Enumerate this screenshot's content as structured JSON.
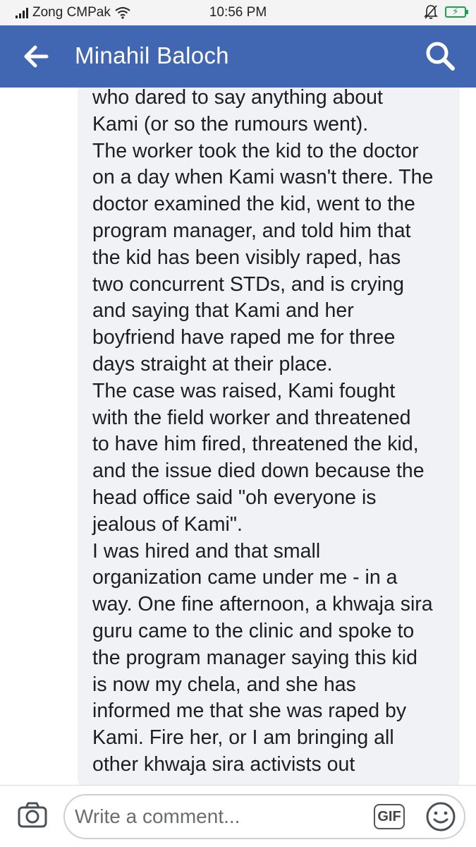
{
  "status_bar": {
    "carrier": "Zong CMPak",
    "time": "10:56 PM",
    "icons": [
      "signal-icon",
      "wifi-icon",
      "alarm-off-icon",
      "battery-charging-icon"
    ]
  },
  "header": {
    "title": "Minahil Baloch",
    "back_icon": "back-arrow-icon",
    "search_icon": "search-icon",
    "background_color": "#4267b2"
  },
  "comment": {
    "lines": [
      "who dared to say anything about",
      "Kami (or so the rumours went).",
      "The worker took the kid to the doctor",
      "on a day when Kami wasn't there. The",
      "doctor examined the kid, went to the",
      "program manager, and told him that",
      "the kid has been visibly raped, has",
      "two concurrent STDs, and is crying",
      "and saying that Kami and her",
      "boyfriend have raped me for three",
      "days straight at their place.",
      "The case was raised, Kami fought",
      "with the field worker and threatened",
      "to have him fired, threatened the kid,",
      "and the issue died down because the",
      "head office said \"oh everyone is",
      "jealous of Kami\".",
      "I was hired and that small",
      "organization came under me - in a",
      "way. One fine afternoon, a khwaja sira",
      "guru came to the clinic and spoke to",
      "the program manager saying this kid",
      "is now my chela, and she has",
      "informed me that she was raped by",
      "Kami. Fire her, or I am bringing all",
      "other khwaja sira activists out"
    ]
  },
  "composer": {
    "placeholder": "Write a comment...",
    "gif_label": "GIF",
    "camera_icon": "camera-icon",
    "emoji_icon": "emoji-icon"
  }
}
